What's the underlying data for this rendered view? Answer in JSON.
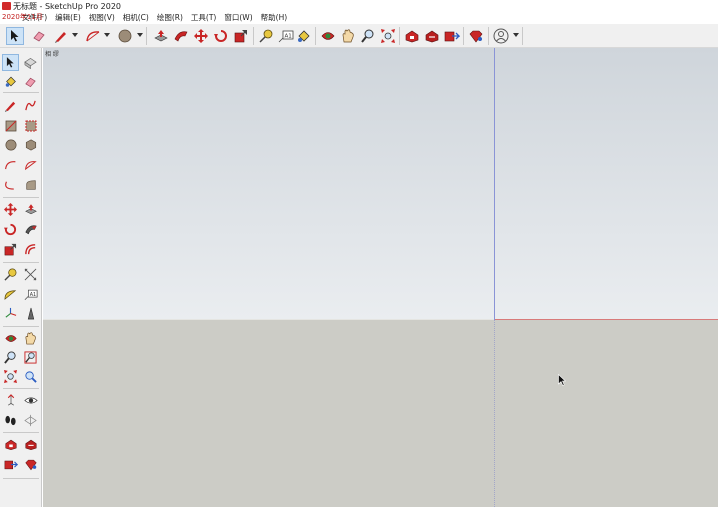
{
  "window": {
    "title": "无标题 - SketchUp Pro 2020",
    "overlay": "2020年11月"
  },
  "menu": {
    "items": [
      "文件(F)",
      "编辑(E)",
      "视图(V)",
      "相机(C)",
      "绘图(R)",
      "工具(T)",
      "窗口(W)",
      "帮助(H)"
    ]
  },
  "viewport": {
    "scene_label": "相 缪"
  },
  "toolbar": {
    "tools": [
      "select-icon",
      "eraser-icon",
      "pencil-icon",
      "arc-icon",
      "circle-icon",
      "push-pull-icon",
      "follow-me-icon",
      "move-icon",
      "rotate-icon",
      "scale-icon",
      "tape-measure-icon",
      "text-icon",
      "paint-bucket-icon",
      "orbit-icon",
      "pan-icon",
      "zoom-icon",
      "zoom-extents-icon",
      "warehouse-icon",
      "extension-icon",
      "share-icon",
      "ruby-icon",
      "user-account-icon"
    ]
  },
  "palette": {
    "tools": [
      "select-icon",
      "make-component-icon",
      "paint-bucket-icon",
      "eraser-icon",
      "line-icon",
      "freehand-icon",
      "rectangle-icon",
      "rotated-rectangle-icon",
      "circle-icon",
      "polygon-icon",
      "arc-icon",
      "pie-icon",
      "two-point-arc-icon",
      "three-point-arc-icon",
      "move-icon",
      "push-pull-icon",
      "rotate-icon",
      "follow-me-icon",
      "scale-icon",
      "offset-icon",
      "tape-measure-icon",
      "dimension-icon",
      "protractor-icon",
      "text-icon",
      "axes-icon",
      "3d-text-icon",
      "orbit-icon",
      "pan-icon",
      "zoom-icon",
      "zoom-window-icon",
      "zoom-extents-icon",
      "previous-view-icon",
      "position-camera-icon",
      "look-around-icon",
      "walk-icon",
      "section-plane-icon",
      "warehouse-icon",
      "extension-warehouse-icon",
      "share-model-icon",
      "ruby-console-icon"
    ]
  },
  "colors": {
    "accent_red": "#c92626",
    "axis_blue": "#8a94d6",
    "axis_red": "#d87a7a",
    "sky_top": "#cfd5db",
    "sky_bottom": "#eaedf0",
    "ground": "#ccccc6"
  }
}
